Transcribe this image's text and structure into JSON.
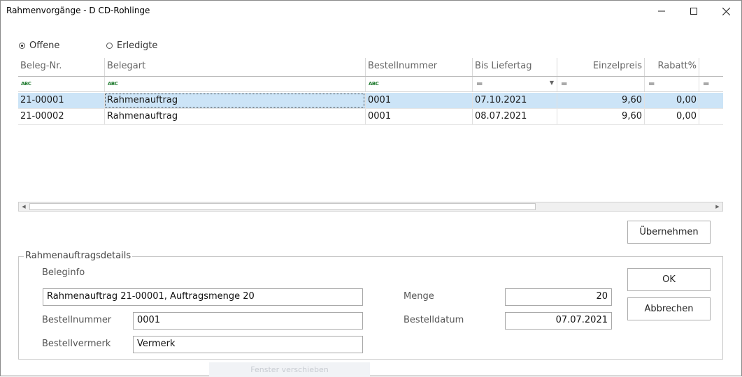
{
  "window": {
    "title": "Rahmenvorgänge - D CD-Rohlinge"
  },
  "filter": {
    "open_label": "Offene",
    "done_label": "Erledigte",
    "selected": "Offene"
  },
  "table": {
    "columns": [
      "Beleg-Nr.",
      "Belegart",
      "Bestellnummer",
      "Bis Liefertag",
      "Einzelpreis",
      "Rabatt%"
    ],
    "rows": [
      {
        "beleg": "21-00001",
        "belegart": "Rahmenauftrag",
        "bestellnummer": "0001",
        "liefertag": "07.10.2021",
        "einzelpreis": "9,60",
        "rabatt": "0,00"
      },
      {
        "beleg": "21-00002",
        "belegart": "Rahmenauftrag",
        "bestellnummer": "0001",
        "liefertag": "08.07.2021",
        "einzelpreis": "9,60",
        "rabatt": "0,00"
      }
    ]
  },
  "buttons": {
    "apply": "Übernehmen",
    "ok": "OK",
    "cancel": "Abbrechen"
  },
  "details": {
    "group_title": "Rahmenauftragsdetails",
    "beleginfo_label": "Beleginfo",
    "beleginfo_value": "Rahmenauftrag 21-00001, Auftragsmenge 20",
    "bestellnummer_label": "Bestellnummer",
    "bestellnummer_value": "0001",
    "bestellvermerk_label": "Bestellvermerk",
    "bestellvermerk_value": "Vermerk",
    "menge_label": "Menge",
    "menge_value": "20",
    "bestelldatum_label": "Bestelldatum",
    "bestelldatum_value": "07.07.2021"
  },
  "background": {
    "hint": "Fenster verschieben"
  }
}
